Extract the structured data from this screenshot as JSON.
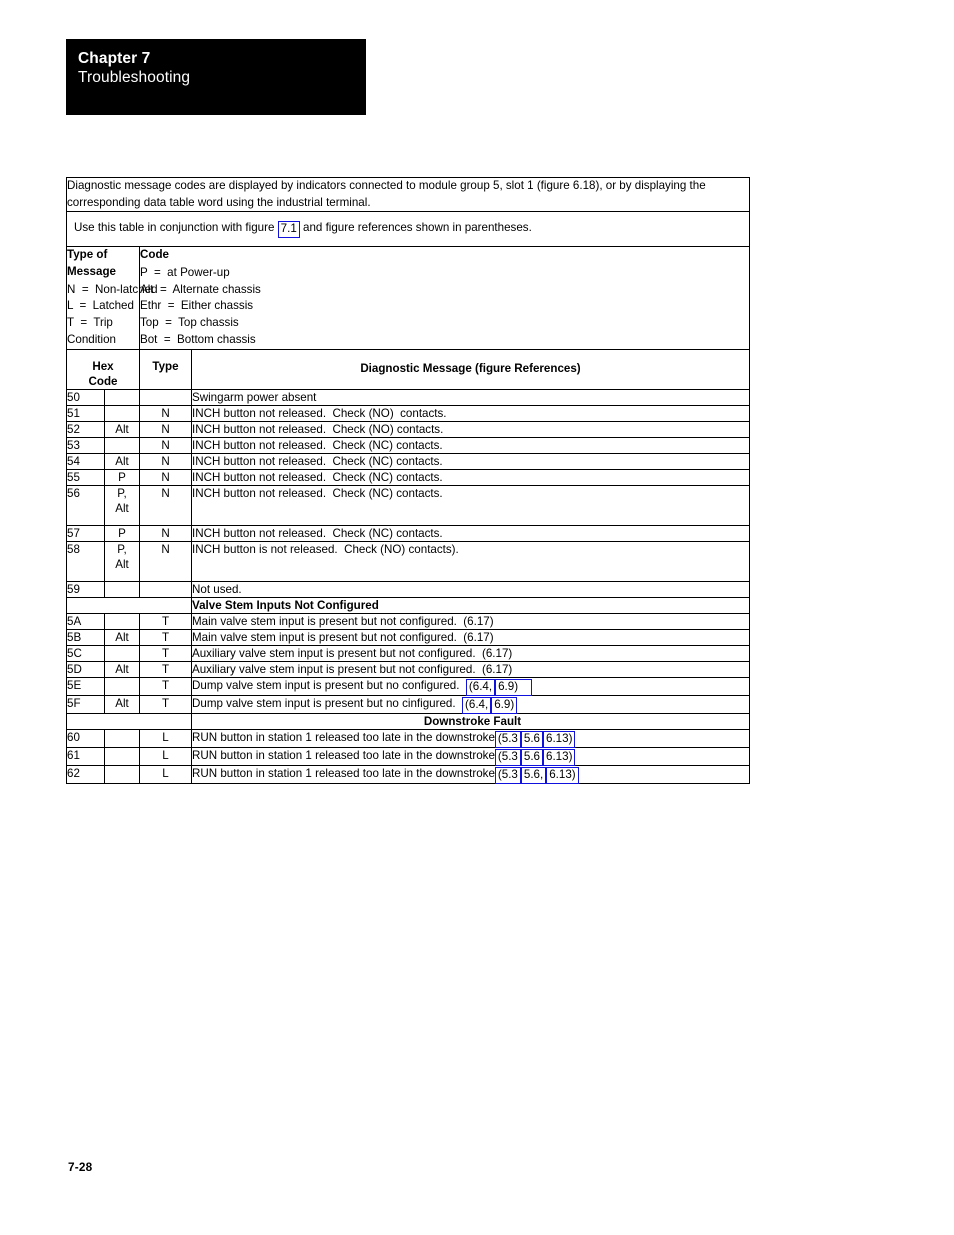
{
  "header": {
    "chapter_number": "Chapter 7",
    "chapter_title": "Troubleshooting"
  },
  "intro": {
    "paragraph_1": "Diagnostic message codes are displayed by indicators connected to module group 5, slot 1 (figure 6.18), or by displaying the corresponding data table word using the industrial terminal.",
    "paragraph_2_before": "Use this table in conjunction with figure ",
    "paragraph_2_link": "7.1",
    "paragraph_2_after": " and figure references shown in parentheses."
  },
  "legend": {
    "type_title": "Type of Message",
    "type_lines": [
      "N  =  Non-latched",
      "L  =  Latched",
      "T  =  Trip",
      "Condition"
    ],
    "code_title": "Code",
    "code_lines": [
      "P  =  at Power-up",
      "Alt  =  Alternate chassis",
      "Ethr  =  Either chassis",
      "Top  =  Top chassis",
      "Bot  =  Bottom chassis"
    ]
  },
  "table": {
    "headers": {
      "hex_code_line1": "Hex",
      "hex_code_line2": "Code",
      "type": "Type",
      "message": "Diagnostic Message (figure  References)"
    },
    "rows": [
      {
        "kind": "data",
        "hex": "50",
        "sub": "",
        "type": "",
        "message": "Swingarm power absent",
        "links": []
      },
      {
        "kind": "data",
        "hex": "51",
        "sub": "",
        "type": "N",
        "message": "INCH button not released.  Check (NO)  contacts.",
        "links": []
      },
      {
        "kind": "data",
        "hex": "52",
        "sub": "Alt",
        "type": "N",
        "message": "INCH button not released.  Check (NO) contacts.",
        "links": []
      },
      {
        "kind": "data",
        "hex": "53",
        "sub": "",
        "type": "N",
        "message": "INCH button not released.  Check (NC) contacts.",
        "links": []
      },
      {
        "kind": "data",
        "hex": "54",
        "sub": "Alt",
        "type": "N",
        "message": "INCH button not released.  Check (NC) contacts.",
        "links": []
      },
      {
        "kind": "data",
        "hex": "55",
        "sub": "P",
        "type": "N",
        "message": "INCH button not released.  Check (NC) contacts.",
        "links": []
      },
      {
        "kind": "data",
        "hex": "56",
        "sub": "P,\nAlt",
        "type": "N",
        "message": "INCH button not released.  Check (NC) contacts.",
        "links": [],
        "tall": true
      },
      {
        "kind": "data",
        "hex": "57",
        "sub": "P",
        "type": "N",
        "message": "INCH button not released.  Check (NC) contacts.",
        "links": []
      },
      {
        "kind": "data",
        "hex": "58",
        "sub": "P,\nAlt",
        "type": "N",
        "message": "INCH button is not released.  Check (NO) contacts).",
        "links": [],
        "tall": true
      },
      {
        "kind": "data",
        "hex": "59",
        "sub": "",
        "type": "",
        "message": "Not used.",
        "links": []
      },
      {
        "kind": "section",
        "title": "Valve Stem Inputs Not Configured",
        "centered": false
      },
      {
        "kind": "data",
        "hex": "5A",
        "sub": "",
        "type": "T",
        "message": "Main valve stem input is present but not configured.  (6.17)",
        "links": []
      },
      {
        "kind": "data",
        "hex": "5B",
        "sub": "Alt",
        "type": "T",
        "message": "Main valve stem input is present but not configured.  (6.17)",
        "links": []
      },
      {
        "kind": "data",
        "hex": "5C",
        "sub": "",
        "type": "T",
        "message": "Auxiliary valve stem input is present but not configured.  (6.17)",
        "links": []
      },
      {
        "kind": "data",
        "hex": "5D",
        "sub": "Alt",
        "type": "T",
        "message": "Auxiliary valve stem input is present but not configured.  (6.17)",
        "links": []
      },
      {
        "kind": "data",
        "hex": "5E",
        "sub": "",
        "type": "T",
        "message": "Dump valve stem input is present but no configured.  ",
        "links": [
          "(6.4,",
          "6.9)"
        ],
        "link_pad_last": true
      },
      {
        "kind": "data",
        "hex": "5F",
        "sub": "Alt",
        "type": "T",
        "message": "Dump valve stem input is present but no cinfigured.  ",
        "links": [
          "(6.4,",
          "6.9)"
        ]
      },
      {
        "kind": "section",
        "title": "Downstroke Fault",
        "centered": true
      },
      {
        "kind": "data",
        "hex": "60",
        "sub": "",
        "type": "L",
        "message": "RUN button in station 1 released too late in the downstroke",
        "links": [
          "(5.3",
          "5.6",
          "6.13)"
        ]
      },
      {
        "kind": "data",
        "hex": "61",
        "sub": "",
        "type": "L",
        "message": "RUN button in station 1 released too late in the downstroke",
        "links": [
          "(5.3",
          "5.6",
          "6.13)"
        ]
      },
      {
        "kind": "data",
        "hex": "62",
        "sub": "",
        "type": "L",
        "message": "RUN button in station 1 released too late in the downstroke",
        "links": [
          "(5.3",
          "5.6,",
          "6.13)"
        ]
      }
    ]
  },
  "footer": {
    "page_number": "7-28"
  },
  "colors": {
    "link_box": "#1111dd",
    "banner_background": "#000000",
    "banner_text": "#ffffff"
  }
}
